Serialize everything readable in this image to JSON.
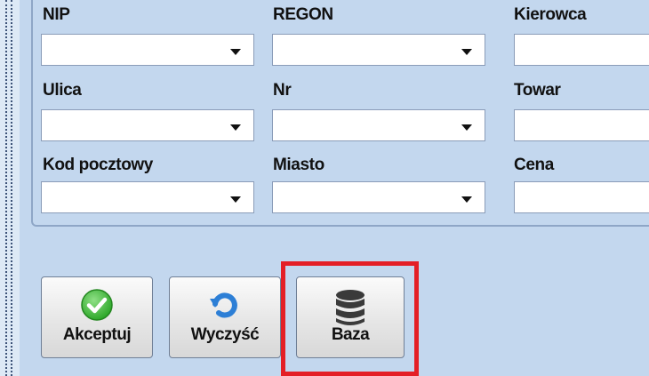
{
  "form": {
    "labels": {
      "nip": "NIP",
      "regon": "REGON",
      "kierowca": "Kierowca",
      "ulica": "Ulica",
      "nr": "Nr",
      "towar": "Towar",
      "kod_pocztowy": "Kod pocztowy",
      "miasto": "Miasto",
      "cena": "Cena"
    },
    "values": {
      "nip": "",
      "regon": "",
      "kierowca": "",
      "ulica": "",
      "nr": "",
      "towar": "",
      "kod_pocztowy": "",
      "miasto": "",
      "cena": ""
    }
  },
  "buttons": {
    "akceptuj": "Akceptuj",
    "wyczysc": "Wyczyść",
    "baza": "Baza"
  },
  "colors": {
    "background": "#c3d7ee",
    "highlight": "#e41f26",
    "accept_green": "#3fbf3a",
    "refresh_blue": "#2d7fd6",
    "database_dark": "#3a3a3a"
  },
  "icons": {
    "akceptuj": "check-circle-icon",
    "wyczysc": "refresh-icon",
    "baza": "database-icon"
  }
}
